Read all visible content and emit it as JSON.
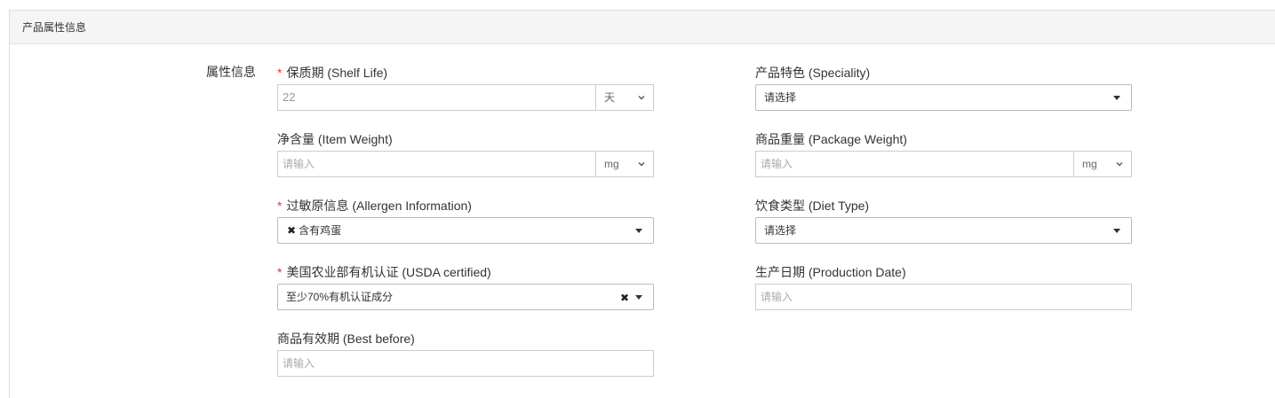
{
  "panel": {
    "title": "产品属性信息"
  },
  "section": {
    "label": "属性信息"
  },
  "fields": {
    "shelf_life": {
      "label": "保质期 (Shelf Life)",
      "required": "*",
      "value": "22",
      "unit": "天"
    },
    "speciality": {
      "label": "产品特色 (Speciality)",
      "value": "请选择"
    },
    "item_weight": {
      "label": "净含量 (Item Weight)",
      "placeholder": "请输入",
      "unit": "mg"
    },
    "package_weight": {
      "label": "商品重量 (Package Weight)",
      "placeholder": "请输入",
      "unit": "mg"
    },
    "allergen": {
      "label": "过敏原信息 (Allergen Information)",
      "required": "*",
      "tag_remove": "✖",
      "tag": "含有鸡蛋"
    },
    "diet_type": {
      "label": "饮食类型 (Diet Type)",
      "value": "请选择"
    },
    "usda": {
      "label": "美国农业部有机认证 (USDA certified)",
      "required": "*",
      "value": "至少70%有机认证成分",
      "clear": "✖"
    },
    "production_date": {
      "label": "生产日期 (Production Date)",
      "placeholder": "请输入"
    },
    "best_before": {
      "label": "商品有效期 (Best before)",
      "placeholder": "请输入"
    }
  }
}
